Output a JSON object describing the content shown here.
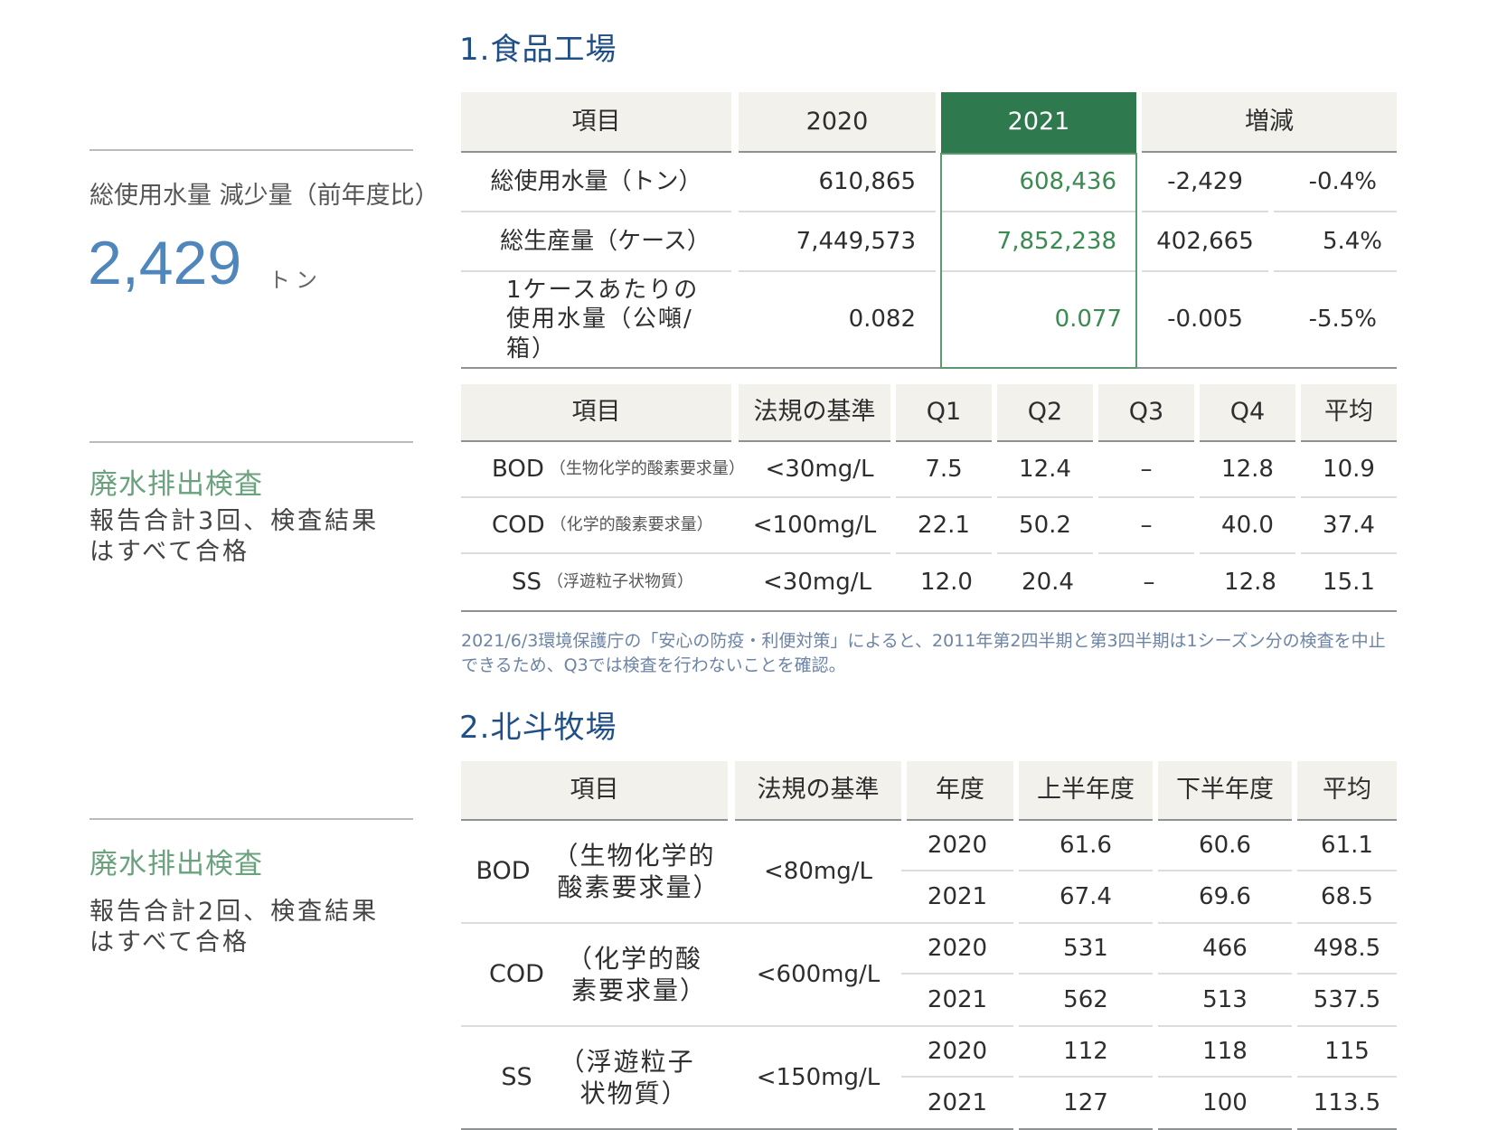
{
  "section1": {
    "title": "1.食品工場",
    "side_label": "総使用水量 減少量（前年度比）",
    "big_number": "2,429",
    "unit": "トン",
    "table1": {
      "headers": [
        "項目",
        "2020",
        "2021",
        "増減"
      ],
      "rows": [
        {
          "label": "総使用水量（トン）",
          "v2020": "610,865",
          "v2021": "608,436",
          "diff": "-2,429",
          "pct": "-0.4%"
        },
        {
          "label": "総生産量（ケース）",
          "v2020": "7,449,573",
          "v2021": "7,852,238",
          "diff": "402,665",
          "pct": "5.4%"
        },
        {
          "label_l1": "1ケースあたりの",
          "label_l2": "使用水量（公噸/箱）",
          "v2020": "0.082",
          "v2021": "0.077",
          "diff": "-0.005",
          "pct": "-5.5%"
        }
      ]
    },
    "waste_title": "廃水排出検査",
    "waste_desc_l1": "報告合計3回、検査結果",
    "waste_desc_l2": "はすべて合格",
    "table2": {
      "headers": [
        "項目",
        "法規の基準",
        "Q1",
        "Q2",
        "Q3",
        "Q4",
        "平均"
      ],
      "rows": [
        {
          "name": "BOD",
          "sub": "（生物化学的酸素要求量）",
          "std": "<30mg/L",
          "q1": "7.5",
          "q2": "12.4",
          "q3": "–",
          "q4": "12.8",
          "avg": "10.9"
        },
        {
          "name": "COD",
          "sub": "（化学的酸素要求量）",
          "std": "<100mg/L",
          "q1": "22.1",
          "q2": "50.2",
          "q3": "–",
          "q4": "40.0",
          "avg": "37.4"
        },
        {
          "name": "SS",
          "sub": "（浮遊粒子状物質）",
          "std": "<30mg/L",
          "q1": "12.0",
          "q2": "20.4",
          "q3": "–",
          "q4": "12.8",
          "avg": "15.1"
        }
      ]
    },
    "note_l1": "2021/6/3環境保護庁の「安心の防疫・利便対策」によると、2011年第2四半期と第3四半期は1シーズン分の検査を中止",
    "note_l2": "できるため、Q3では検査を行わないことを確認。"
  },
  "section2": {
    "title": "2.北斗牧場",
    "waste_title": "廃水排出検査",
    "waste_desc_l1": "報告合計2回、検査結果",
    "waste_desc_l2": "はすべて合格",
    "table": {
      "headers": [
        "項目",
        "法規の基準",
        "年度",
        "上半年度",
        "下半年度",
        "平均"
      ],
      "groups": [
        {
          "name": "BOD",
          "sub_l1": "（生物化学的",
          "sub_l2": "酸素要求量）",
          "std": "<80mg/L",
          "rows": [
            {
              "year": "2020",
              "h1": "61.6",
              "h2": "60.6",
              "avg": "61.1"
            },
            {
              "year": "2021",
              "h1": "67.4",
              "h2": "69.6",
              "avg": "68.5"
            }
          ]
        },
        {
          "name": "COD",
          "sub_l1": "（化学的酸",
          "sub_l2": "素要求量）",
          "std": "<600mg/L",
          "rows": [
            {
              "year": "2020",
              "h1": "531",
              "h2": "466",
              "avg": "498.5"
            },
            {
              "year": "2021",
              "h1": "562",
              "h2": "513",
              "avg": "537.5"
            }
          ]
        },
        {
          "name": "SS",
          "sub_l1": "（浮遊粒子",
          "sub_l2": "状物質）",
          "std": "<150mg/L",
          "rows": [
            {
              "year": "2020",
              "h1": "112",
              "h2": "118",
              "avg": "115"
            },
            {
              "year": "2021",
              "h1": "127",
              "h2": "100",
              "avg": "113.5"
            }
          ]
        }
      ]
    }
  },
  "colors": {
    "accent_blue": "#1f4f86",
    "number_blue": "#4f86bb",
    "green": "#2e7a4e",
    "green_text": "#3a8a52",
    "note_blue": "#6d84a6"
  }
}
